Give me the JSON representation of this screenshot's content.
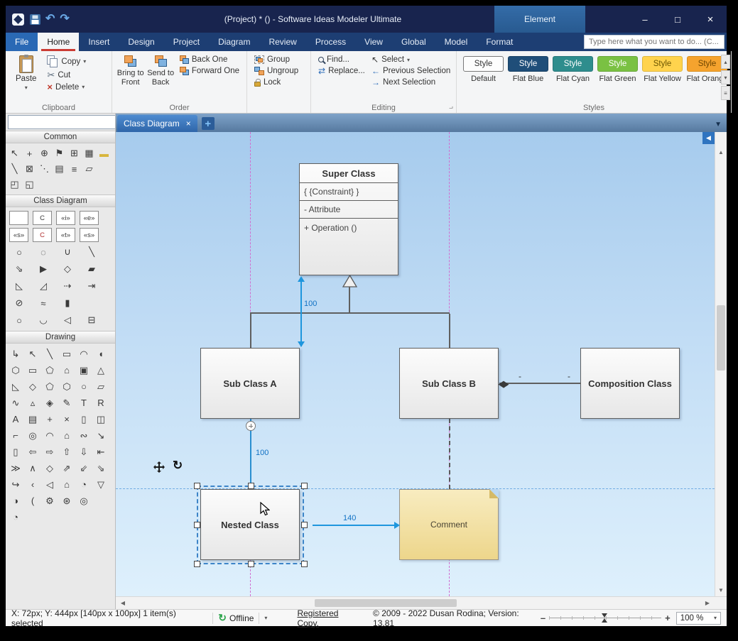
{
  "window": {
    "title": "(Project) * () - Software Ideas Modeler Ultimate",
    "contextual_tab": "Element"
  },
  "icons": {
    "undo": "↶",
    "redo": "↷",
    "minimize": "–",
    "maximize": "□",
    "close": "×",
    "cut": "✂",
    "delete": "×",
    "dropdown": "▾",
    "prev": "←",
    "next": "→",
    "replace": "⇄",
    "select_arrow": "↖",
    "launcher": "⌐",
    "tab_close": "×",
    "tab_add": "+",
    "tab_menu": "▼",
    "collapse": "◀",
    "scroll_up": "▲",
    "scroll_down": "▼",
    "scroll_left": "◀",
    "scroll_right": "▶",
    "gallery_up": "▴",
    "gallery_down": "▾",
    "gallery_expand": "≡",
    "offline": "↻",
    "zoom_out": "–",
    "zoom_in": "+",
    "diamond": "◆"
  },
  "menu": {
    "tabs": [
      {
        "label": "File",
        "cls": "file"
      },
      {
        "label": "Home",
        "cls": "active"
      },
      {
        "label": "Insert"
      },
      {
        "label": "Design"
      },
      {
        "label": "Project"
      },
      {
        "label": "Diagram"
      },
      {
        "label": "Review"
      },
      {
        "label": "Process"
      },
      {
        "label": "View"
      },
      {
        "label": "Global"
      },
      {
        "label": "Model"
      },
      {
        "label": "Format"
      }
    ],
    "search_placeholder": "Type here what you want to do... (C..."
  },
  "ribbon": {
    "clipboard": {
      "label": "Clipboard",
      "paste": "Paste",
      "copy": "Copy",
      "cut": "Cut",
      "delete": "Delete"
    },
    "order": {
      "label": "Order",
      "bring_to_front": "Bring to Front",
      "send_to_back": "Send to Back",
      "back_one": "Back One",
      "forward_one": "Forward One"
    },
    "grouping": {
      "label": "",
      "group": "Group",
      "ungroup": "Ungroup",
      "lock": "Lock"
    },
    "editing": {
      "label": "Editing",
      "find": "Find...",
      "replace": "Replace...",
      "select": "Select",
      "previous": "Previous Selection",
      "next": "Next Selection"
    },
    "styles": {
      "label": "Styles",
      "tile_text": "Style",
      "items": [
        {
          "name": "Default",
          "bg": "#fdfdfd",
          "fg": "#333333",
          "bc": "#7a7a7a",
          "cls": "sel"
        },
        {
          "name": "Flat Blue",
          "bg": "#1f4e79",
          "fg": "#ffffff",
          "bc": "#1a4265"
        },
        {
          "name": "Flat Cyan",
          "bg": "#2e8d8d",
          "fg": "#ffffff",
          "bc": "#27777a"
        },
        {
          "name": "Flat Green",
          "bg": "#7ac143",
          "fg": "#ffffff",
          "bc": "#68a639"
        },
        {
          "name": "Flat Yellow",
          "bg": "#ffd34d",
          "fg": "#6a5500",
          "bc": "#e0b73a"
        },
        {
          "name": "Flat Orange",
          "bg": "#f5a32e",
          "fg": "#6e4500",
          "bc": "#d98e1b"
        }
      ]
    }
  },
  "toolbox": {
    "section_common": "Common",
    "section_class": "Class Diagram",
    "section_drawing": "Drawing",
    "common_icons": [
      {
        "n": "pointer-tool",
        "g": "↖"
      },
      {
        "n": "move-tool",
        "g": "+"
      },
      {
        "n": "zoom-tool",
        "g": "⊕"
      },
      {
        "n": "flag-tool",
        "g": "⚑"
      },
      {
        "n": "align-tool",
        "g": "⊞"
      },
      {
        "n": "table-tool",
        "g": "▦"
      },
      {
        "n": "sticky-note-tool",
        "g": "▬",
        "c": "#d8b63c"
      },
      {
        "cls": "br"
      },
      {
        "n": "line-tool",
        "g": "╲"
      },
      {
        "n": "container-tool",
        "g": "⊠"
      },
      {
        "n": "freehand-tool",
        "g": "⋱"
      },
      {
        "n": "printer-tool",
        "g": "▤"
      },
      {
        "n": "document-tool",
        "g": "≡"
      },
      {
        "n": "folder-tool",
        "g": "▱"
      },
      {
        "cls": "br"
      },
      {
        "n": "panel-left-tool",
        "g": "◰"
      },
      {
        "n": "panel-split-tool",
        "g": "◱"
      }
    ],
    "class_icons": [
      {
        "n": "class-tool",
        "g": "",
        "cls": "boxed"
      },
      {
        "n": "class-c-tool",
        "g": "C",
        "cls": "boxed"
      },
      {
        "n": "interface-tool",
        "g": "«i»",
        "cls": "boxed"
      },
      {
        "n": "enumeration-tool",
        "g": "«e»",
        "cls": "boxed"
      },
      {
        "cls": "br"
      },
      {
        "n": "signal-tool",
        "g": "«s»",
        "cls": "boxed"
      },
      {
        "n": "exception-tool",
        "g": "C",
        "c": "#b03030",
        "cls": "boxed"
      },
      {
        "n": "template-class-tool",
        "g": "«t»",
        "cls": "boxed"
      },
      {
        "n": "stereotyped-class-tool",
        "g": "«s»",
        "cls": "boxed"
      },
      {
        "cls": "br"
      },
      {
        "n": "ellipse-tool",
        "g": "○"
      },
      {
        "n": "dashed-ellipse-tool",
        "g": "◌"
      },
      {
        "n": "use-case-tool",
        "g": "∪"
      },
      {
        "n": "diagonal-line-tool",
        "g": "╲"
      },
      {
        "cls": "br"
      },
      {
        "n": "association-tool",
        "g": "⇘"
      },
      {
        "n": "directed-association-tool",
        "g": "▶"
      },
      {
        "n": "diamond-tool",
        "g": "◇"
      },
      {
        "n": "parallelogram-tool",
        "g": "▰"
      },
      {
        "cls": "br"
      },
      {
        "n": "generalization-tool",
        "g": "◺"
      },
      {
        "n": "realization-tool",
        "g": "◿"
      },
      {
        "n": "dependency-tool",
        "g": "⇢"
      },
      {
        "n": "anchored-line-tool",
        "g": "⇥"
      },
      {
        "cls": "br"
      },
      {
        "n": "circle-slash-tool",
        "g": "⊘"
      },
      {
        "n": "wave-connector-tool",
        "g": "≈"
      },
      {
        "n": "bar-tool",
        "g": "▮"
      },
      {
        "cls": "br"
      },
      {
        "n": "circle-shape-tool",
        "g": "○"
      },
      {
        "n": "arc-tool",
        "g": "◡"
      },
      {
        "n": "triangle-side-tool",
        "g": "◁"
      },
      {
        "n": "rect-section-tool",
        "g": "⊟"
      }
    ],
    "drawing_icons": [
      {
        "n": "corner-arrow-tool",
        "g": "↳"
      },
      {
        "n": "arrow-nw-tool",
        "g": "↖"
      },
      {
        "n": "line-draw-tool",
        "g": "╲"
      },
      {
        "n": "rectangle-tool",
        "g": "▭"
      },
      {
        "n": "arc-draw-tool",
        "g": "◠"
      },
      {
        "n": "half-circle-tool",
        "g": "◖"
      },
      {
        "cls": "br"
      },
      {
        "n": "hexagon-tool",
        "g": "⬡"
      },
      {
        "n": "rounded-rect-tool",
        "g": "▭"
      },
      {
        "n": "pentagon-tool",
        "g": "⬠"
      },
      {
        "n": "house-tool",
        "g": "⌂"
      },
      {
        "n": "square-tool",
        "g": "▣"
      },
      {
        "n": "triangle-tool",
        "g": "△"
      },
      {
        "cls": "br"
      },
      {
        "n": "right-triangle-tool",
        "g": "◺"
      },
      {
        "n": "diamond-draw-tool",
        "g": "◇"
      },
      {
        "n": "polygon-tool",
        "g": "⬠"
      },
      {
        "n": "hexagon2-tool",
        "g": "⬡"
      },
      {
        "n": "circle-draw-tool",
        "g": "○"
      },
      {
        "n": "parallelogram-draw-tool",
        "g": "▱"
      },
      {
        "cls": "br"
      },
      {
        "n": "curve-tool",
        "g": "∿"
      },
      {
        "n": "small-triangle-tool",
        "g": "▵"
      },
      {
        "n": "diamond-star-tool",
        "g": "◈"
      },
      {
        "n": "pencil-tool",
        "g": "✎"
      },
      {
        "n": "text-tool",
        "g": "T"
      },
      {
        "n": "rich-text-tool",
        "g": "R"
      },
      {
        "cls": "br"
      },
      {
        "n": "label-tool",
        "g": "A"
      },
      {
        "n": "image-tool",
        "g": "▤"
      },
      {
        "n": "plus-shape-tool",
        "g": "+"
      },
      {
        "n": "cross-shape-tool",
        "g": "×"
      },
      {
        "n": "vertical-rect-tool",
        "g": "▯"
      },
      {
        "n": "split-rect-tool",
        "g": "◫"
      },
      {
        "cls": "br"
      },
      {
        "n": "bracket-tool",
        "g": "⌐"
      },
      {
        "n": "target-tool",
        "g": "◎"
      },
      {
        "n": "arc2-tool",
        "g": "◠"
      },
      {
        "n": "home-shape-tool",
        "g": "⌂"
      },
      {
        "n": "tilde-tool",
        "g": "∾"
      },
      {
        "n": "resize-arrow-tool",
        "g": "↘"
      },
      {
        "cls": "br"
      },
      {
        "n": "card-tool",
        "g": "▯"
      },
      {
        "n": "block-arrow-left-tool",
        "g": "⇦"
      },
      {
        "n": "block-arrow-right-tool",
        "g": "⇨"
      },
      {
        "n": "block-arrow-up-tool",
        "g": "⇧"
      },
      {
        "n": "block-arrow-down-tool",
        "g": "⇩"
      },
      {
        "n": "arrow-to-bar-tool",
        "g": "⇤"
      },
      {
        "cls": "br"
      },
      {
        "n": "chevron-tool",
        "g": "≫"
      },
      {
        "n": "caret-tool",
        "g": "∧"
      },
      {
        "n": "callout-diamond-tool",
        "g": "◇"
      },
      {
        "n": "arrow-ne-tool",
        "g": "⇗"
      },
      {
        "n": "arrow-sw-tool",
        "g": "⇙"
      },
      {
        "n": "arrow-se-tool",
        "g": "⇘"
      },
      {
        "cls": "br"
      },
      {
        "n": "hand-tool",
        "g": "↪"
      },
      {
        "n": "angle-bracket-tool",
        "g": "‹"
      },
      {
        "n": "triangle-left-tool",
        "g": "◁"
      },
      {
        "n": "house2-tool",
        "g": "⌂"
      },
      {
        "n": "pie-tool",
        "g": "◔"
      },
      {
        "n": "triangle-down-tool",
        "g": "▽"
      },
      {
        "cls": "br"
      },
      {
        "n": "half-moon-tool",
        "g": "◑"
      },
      {
        "n": "paren-tool",
        "g": "("
      },
      {
        "n": "gear-tool",
        "g": "⚙"
      },
      {
        "n": "asterisk-circle-tool",
        "g": "⊛"
      },
      {
        "n": "bullseye-tool",
        "g": "◎"
      },
      {
        "cls": "br"
      },
      {
        "n": "quarter-circle-tool",
        "g": "◔"
      }
    ]
  },
  "canvas": {
    "tab": "Class Diagram",
    "shapes": {
      "super_title": "Super Class",
      "constraint": "{ {Constraint} }",
      "attribute": "- Attribute",
      "operation": "+ Operation ()",
      "sub_a": "Sub Class A",
      "sub_b": "Sub Class B",
      "composition": "Composition Class",
      "nested": "Nested Class",
      "comment": "Comment"
    },
    "labels": {
      "dim_top": "100",
      "dim_mid": "100",
      "dim_right": "140",
      "mult_left": "-",
      "mult_right": "-"
    }
  },
  "statusbar": {
    "position": "X: 72px; Y: 444px  [140px x 100px] 1 item(s) selected",
    "offline": "Offline",
    "registered": "Registered Copy.",
    "copyright": "© 2009 - 2022 Dusan Rodina; Version: 13.81",
    "zoom_value": "100 %"
  }
}
